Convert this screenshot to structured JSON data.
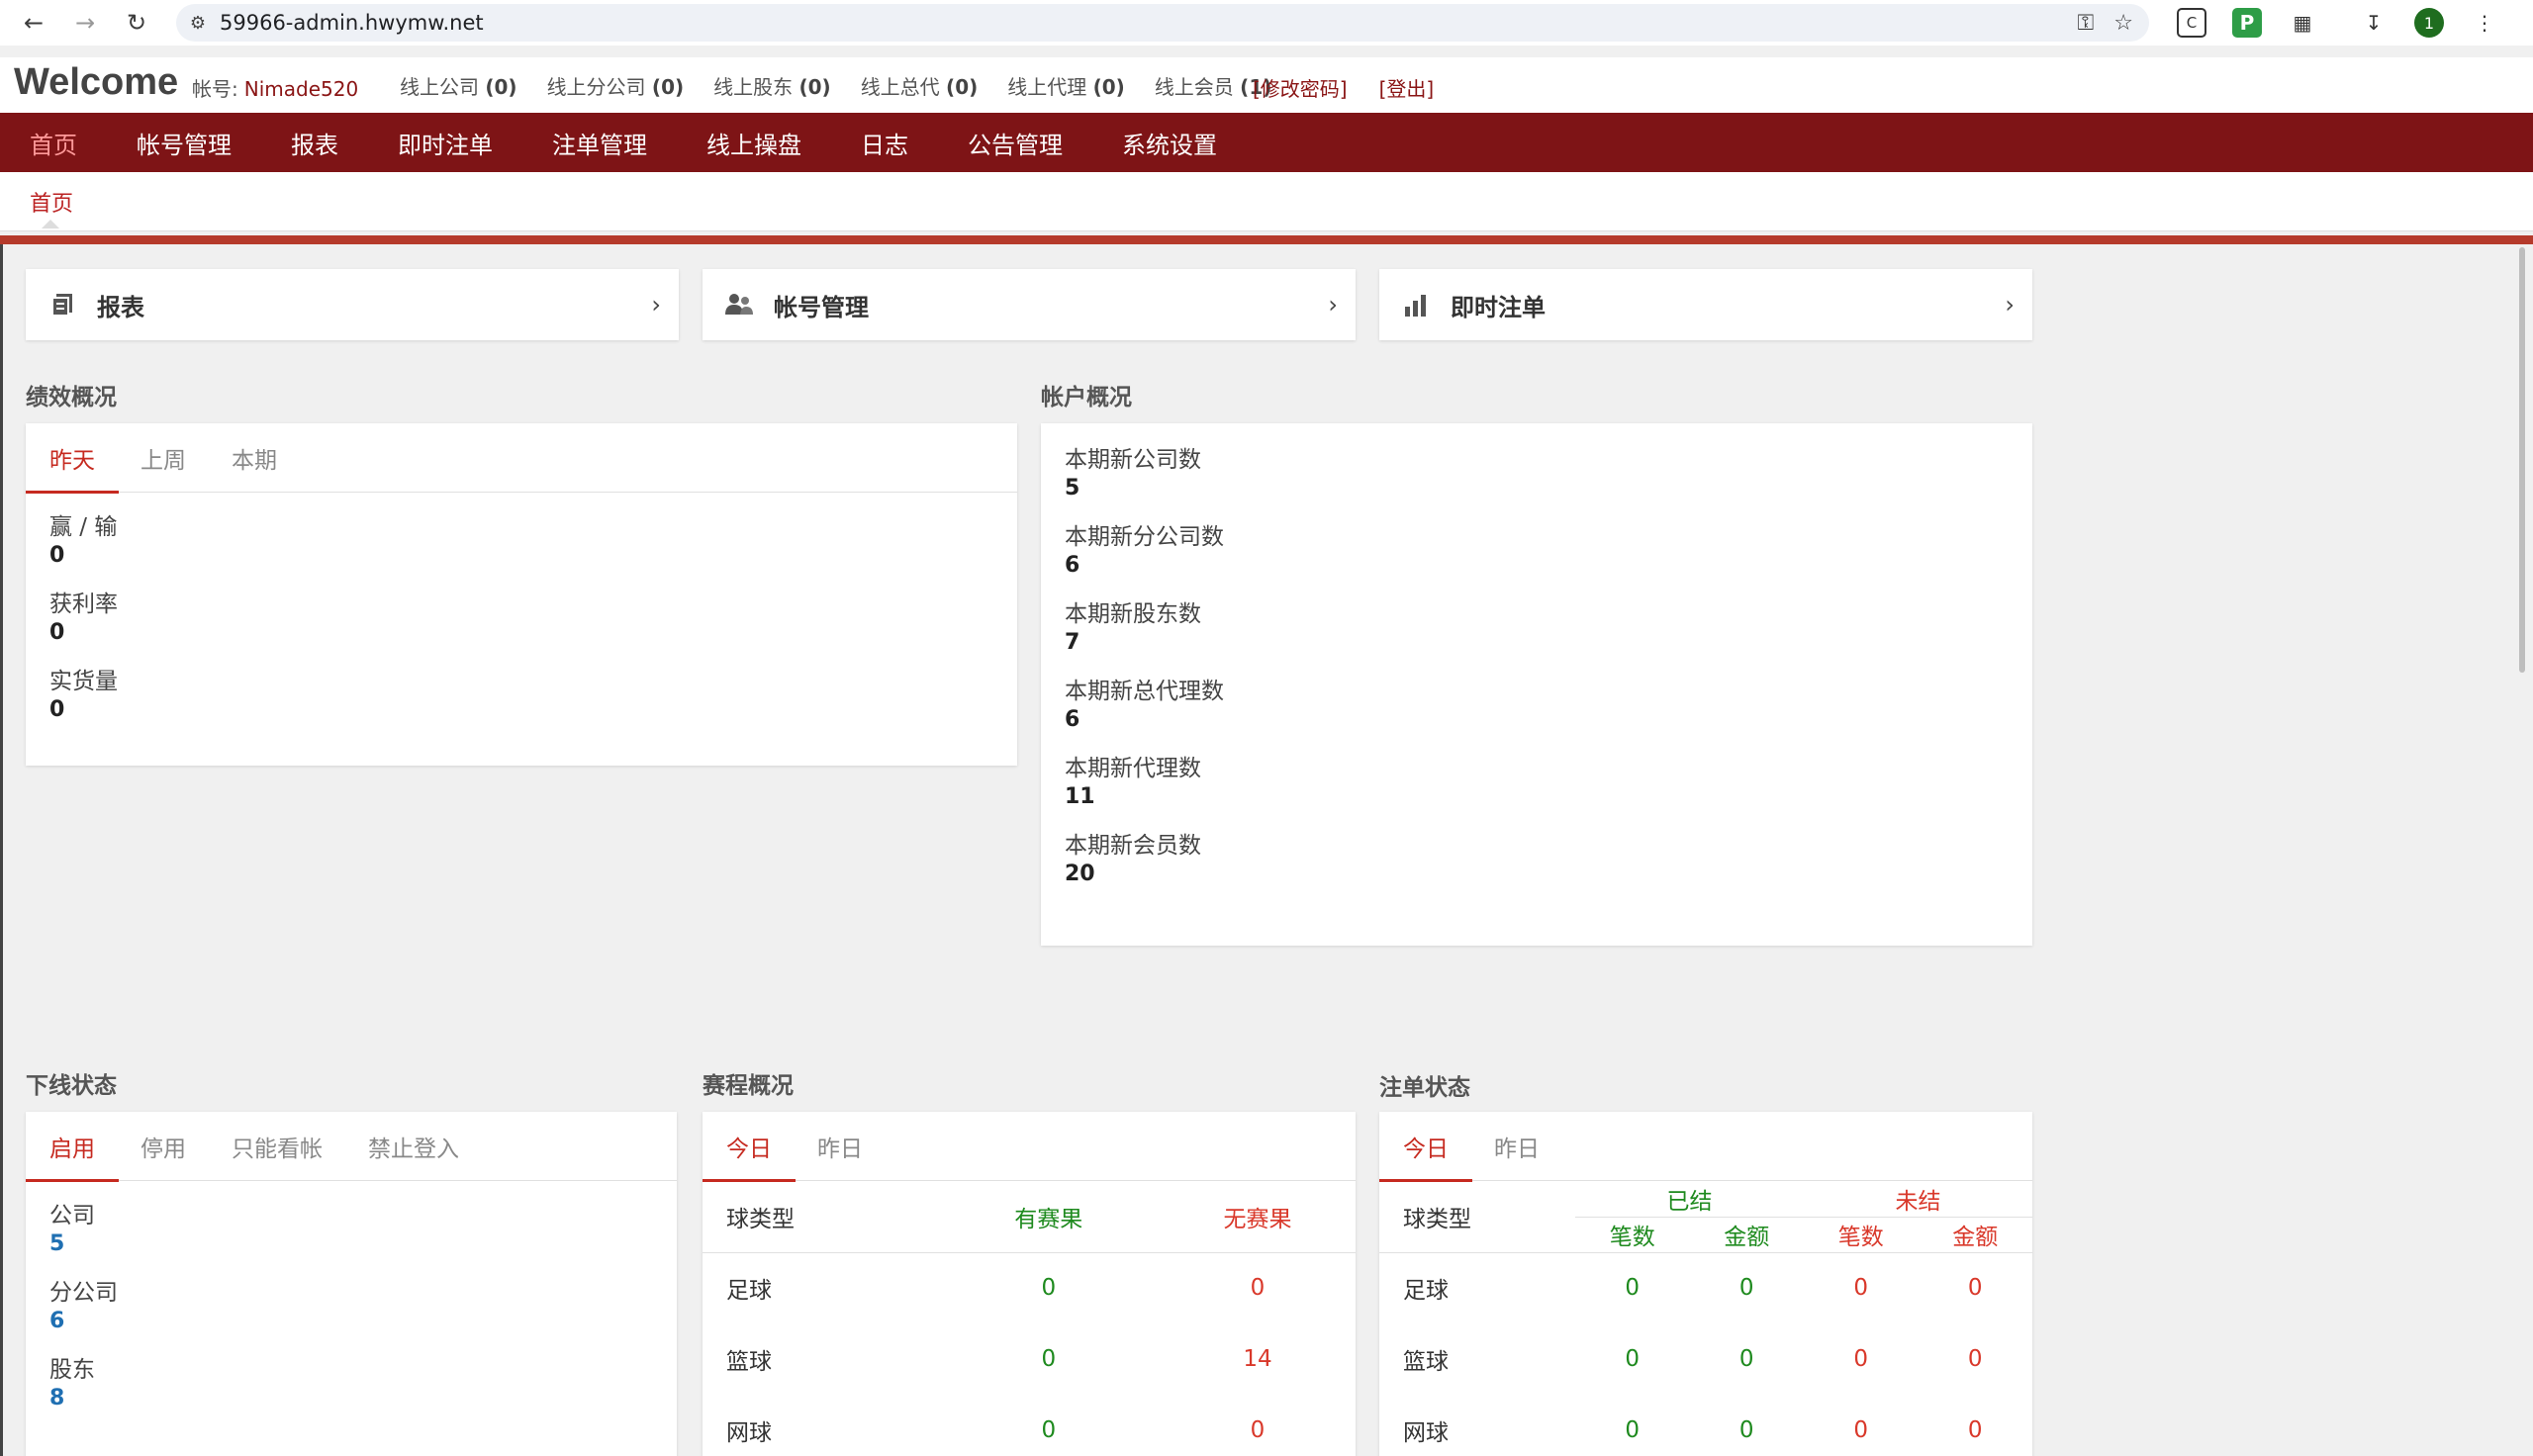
{
  "browser": {
    "url": "59966-admin.hwymw.net",
    "avatar_label": "1"
  },
  "header": {
    "welcome": "Welcome",
    "account_label": "帐号:",
    "account_name": "Nimade520",
    "online_stats": [
      {
        "label": "线上公司",
        "count": "(0)"
      },
      {
        "label": "线上分公司",
        "count": "(0)"
      },
      {
        "label": "线上股东",
        "count": "(0)"
      },
      {
        "label": "线上总代",
        "count": "(0)"
      },
      {
        "label": "线上代理",
        "count": "(0)"
      },
      {
        "label": "线上会员",
        "count": "(1)"
      }
    ],
    "change_password": "[修改密码]",
    "logout": "[登出]"
  },
  "menu": {
    "items": [
      "首页",
      "帐号管理",
      "报表",
      "即时注单",
      "注单管理",
      "线上操盘",
      "日志",
      "公告管理",
      "系统设置"
    ],
    "sub_item": "首页"
  },
  "quick_nav": [
    {
      "label": "报表",
      "icon": "document-icon"
    },
    {
      "label": "帐号管理",
      "icon": "users-icon"
    },
    {
      "label": "即时注单",
      "icon": "bar-chart-icon"
    }
  ],
  "performance": {
    "title": "绩效概况",
    "tabs": [
      "昨天",
      "上周",
      "本期"
    ],
    "items": [
      {
        "label": "赢 / 输",
        "value": "0"
      },
      {
        "label": "获利率",
        "value": "0"
      },
      {
        "label": "实货量",
        "value": "0"
      }
    ]
  },
  "accounts": {
    "title": "帐户概况",
    "items": [
      {
        "label": "本期新公司数",
        "value": "5"
      },
      {
        "label": "本期新分公司数",
        "value": "6"
      },
      {
        "label": "本期新股东数",
        "value": "7"
      },
      {
        "label": "本期新总代理数",
        "value": "6"
      },
      {
        "label": "本期新代理数",
        "value": "11"
      },
      {
        "label": "本期新会员数",
        "value": "20"
      }
    ]
  },
  "downline": {
    "title": "下线状态",
    "tabs": [
      "启用",
      "停用",
      "只能看帐",
      "禁止登入"
    ],
    "items": [
      {
        "label": "公司",
        "value": "5"
      },
      {
        "label": "分公司",
        "value": "6"
      },
      {
        "label": "股东",
        "value": "8"
      }
    ]
  },
  "schedule": {
    "title": "赛程概况",
    "tabs": [
      "今日",
      "昨日"
    ],
    "headers": [
      "球类型",
      "有赛果",
      "无赛果"
    ],
    "rows": [
      {
        "sport": "足球",
        "with": "0",
        "without": "0"
      },
      {
        "sport": "篮球",
        "with": "0",
        "without": "14"
      },
      {
        "sport": "网球",
        "with": "0",
        "without": "0"
      }
    ]
  },
  "bets": {
    "title": "注单状态",
    "tabs": [
      "今日",
      "昨日"
    ],
    "sport_header": "球类型",
    "settled": "已结",
    "unsettled": "未结",
    "count_label": "笔数",
    "amount_label": "金额",
    "rows": [
      {
        "sport": "足球",
        "s_count": "0",
        "s_amount": "0",
        "u_count": "0",
        "u_amount": "0"
      },
      {
        "sport": "篮球",
        "s_count": "0",
        "s_amount": "0",
        "u_count": "0",
        "u_amount": "0"
      },
      {
        "sport": "网球",
        "s_count": "0",
        "s_amount": "0",
        "u_count": "0",
        "u_amount": "0"
      }
    ]
  },
  "colors": {
    "menu_bg": "#7e1416",
    "accent_red": "#c62a20",
    "green": "#1e8a1e",
    "blue": "#1f6fb2"
  }
}
